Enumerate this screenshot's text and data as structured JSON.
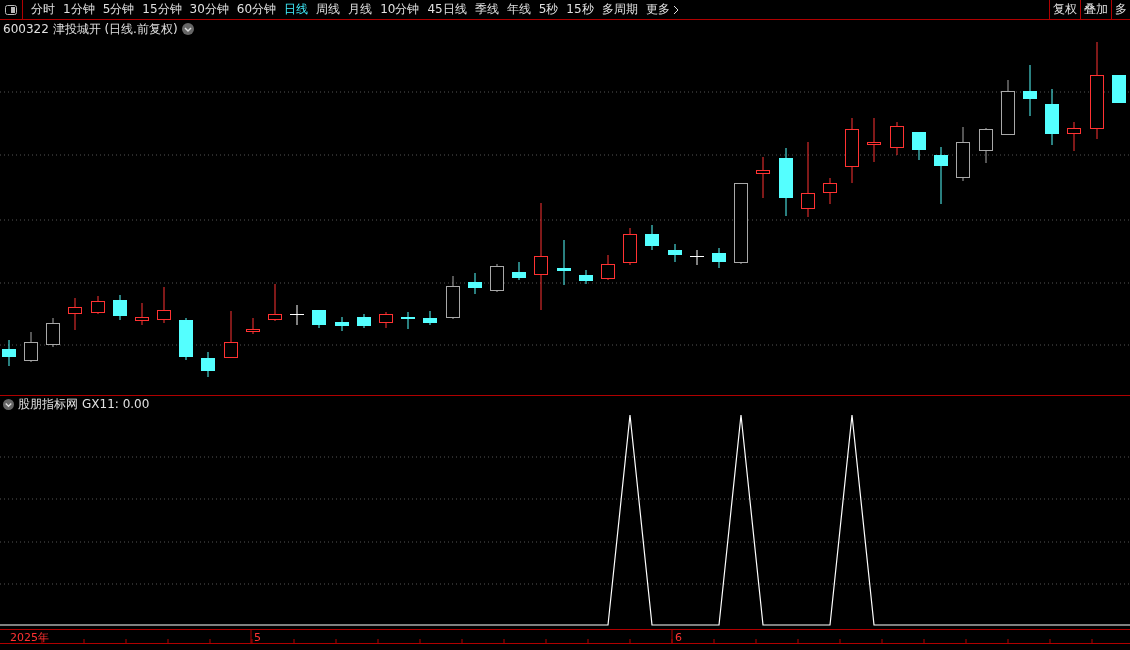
{
  "toolbar": {
    "periods": [
      {
        "label": "分时",
        "selected": false
      },
      {
        "label": "1分钟",
        "selected": false
      },
      {
        "label": "5分钟",
        "selected": false
      },
      {
        "label": "15分钟",
        "selected": false
      },
      {
        "label": "30分钟",
        "selected": false
      },
      {
        "label": "60分钟",
        "selected": false
      },
      {
        "label": "日线",
        "selected": true
      },
      {
        "label": "周线",
        "selected": false
      },
      {
        "label": "月线",
        "selected": false
      },
      {
        "label": "10分钟",
        "selected": false
      },
      {
        "label": "45日线",
        "selected": false
      },
      {
        "label": "季线",
        "selected": false
      },
      {
        "label": "年线",
        "selected": false
      },
      {
        "label": "5秒",
        "selected": false
      },
      {
        "label": "15秒",
        "selected": false
      },
      {
        "label": "多周期",
        "selected": false
      }
    ],
    "more": "更多",
    "right_buttons": [
      "复权",
      "叠加",
      "多"
    ]
  },
  "main_chart": {
    "title": "600322 津投城开 (日线.前复权)"
  },
  "indicator": {
    "name": "股朋指标网",
    "reading": "GX11: 0.00"
  },
  "time_axis": {
    "labels": [
      "2025年",
      "5",
      "6"
    ]
  }
}
